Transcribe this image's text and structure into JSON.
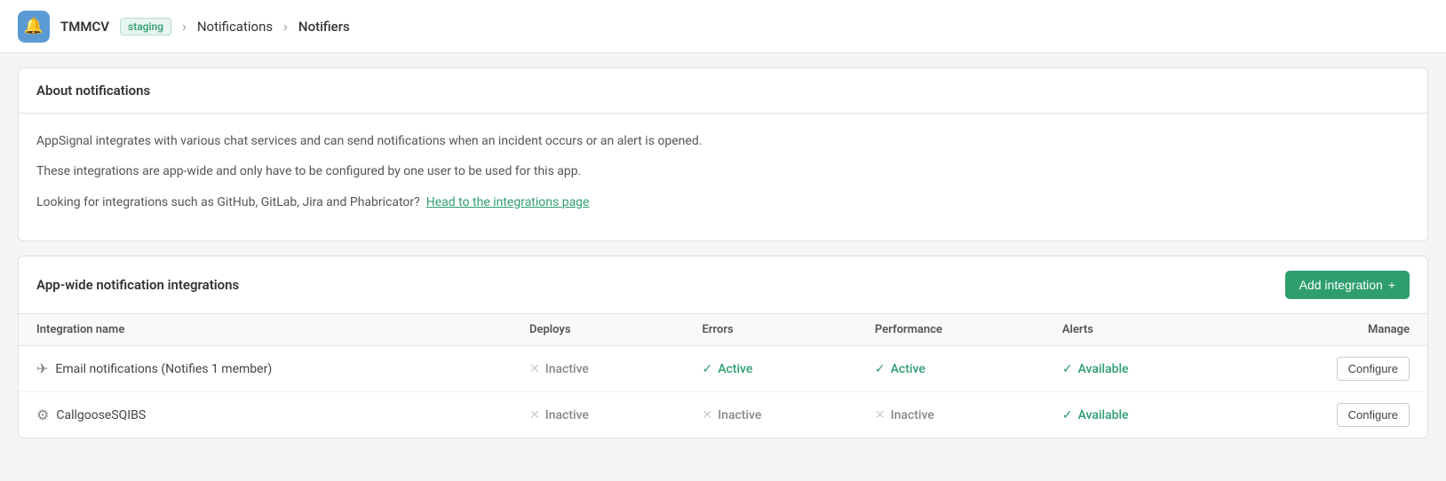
{
  "header": {
    "bell_icon": "bell",
    "org_name": "TMMCV",
    "env_badge": "staging",
    "breadcrumb": [
      {
        "label": "Notifications",
        "link": true
      },
      {
        "label": "Notifiers",
        "link": false
      }
    ]
  },
  "about_section": {
    "title": "About notifications",
    "body_line1": "AppSignal integrates with various chat services and can send notifications when an incident occurs or an alert is opened.",
    "body_line2": "These integrations are app-wide and only have to be configured by one user to be used for this app.",
    "body_line3": "Looking for integrations such as GitHub, GitLab, Jira and Phabricator?",
    "link_text": "Head to the integrations page"
  },
  "integrations_section": {
    "title": "App-wide notification integrations",
    "add_button_label": "Add integration",
    "table": {
      "columns": [
        {
          "key": "name",
          "label": "Integration name"
        },
        {
          "key": "deploys",
          "label": "Deploys"
        },
        {
          "key": "errors",
          "label": "Errors"
        },
        {
          "key": "performance",
          "label": "Performance"
        },
        {
          "key": "alerts",
          "label": "Alerts"
        },
        {
          "key": "manage",
          "label": "Manage"
        }
      ],
      "rows": [
        {
          "id": "email-notif",
          "icon": "✈",
          "name": "Email notifications (Notifies 1 member)",
          "deploys": {
            "status": "inactive",
            "label": "Inactive"
          },
          "errors": {
            "status": "active",
            "label": "Active"
          },
          "performance": {
            "status": "active",
            "label": "Active"
          },
          "alerts": {
            "status": "available",
            "label": "Available"
          },
          "manage_label": "Configure"
        },
        {
          "id": "callgoose",
          "icon": "⚙",
          "name": "CallgooseSQIBS",
          "deploys": {
            "status": "inactive",
            "label": "Inactive"
          },
          "errors": {
            "status": "inactive",
            "label": "Inactive"
          },
          "performance": {
            "status": "inactive",
            "label": "Inactive"
          },
          "alerts": {
            "status": "available",
            "label": "Available"
          },
          "manage_label": "Configure"
        }
      ]
    }
  }
}
